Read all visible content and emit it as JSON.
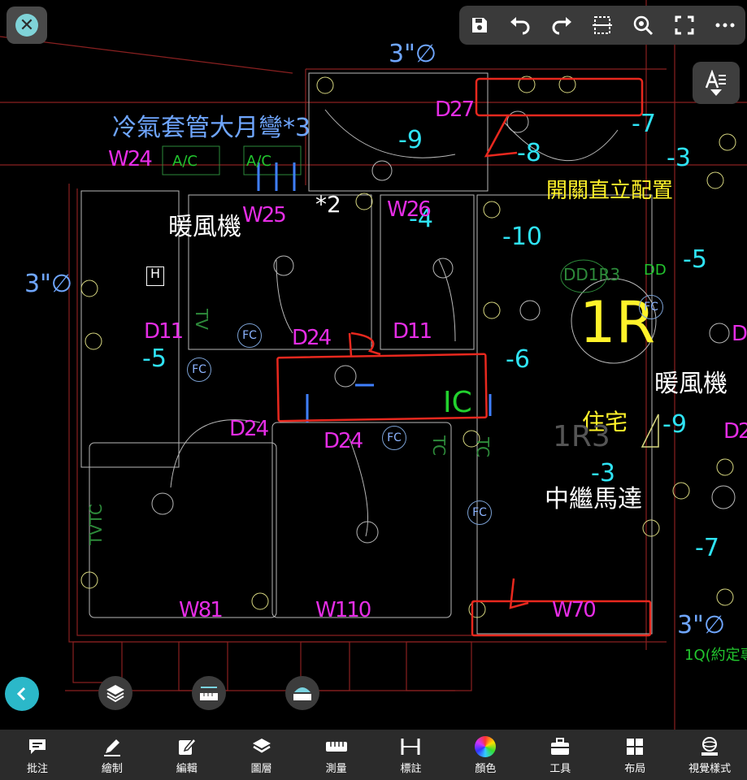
{
  "labels": {
    "pipe_top": "3\"∅",
    "aircon_sleeve": "冷氣套管大月彎*3",
    "heater_left": "暖風機",
    "pipe_left": "3\"∅",
    "switch_vertical": "開關直立配置",
    "heater_right": "暖風機",
    "residence": "住宅",
    "relay_motor": "中繼馬達",
    "pipe_right": "3\"∅",
    "footer_green": "1Q(約定專",
    "ac_1": "A/C",
    "ac_2": "A/C",
    "times_two": "*2",
    "ic": "IC",
    "room_1r": "1R",
    "dd1r3": "DD1R3",
    "r1r3": "1R3",
    "dd": "DD",
    "h_box": "H",
    "d_right": "D",
    "d2_right": "D2",
    "tvtc_1": "TVTC",
    "tvtc_2": "TV",
    "tvtc_3": "TC",
    "tvtc_4": "TC"
  },
  "numbers": {
    "n_minus9_a": "-9",
    "n_minus7_a": "-7",
    "n_minus8": "-8",
    "n_minus3_a": "-3",
    "n_minus4": "-4",
    "n_minus10": "-10",
    "n_minus5_a": "-5",
    "n_minus5_b": "-5",
    "n_minus6": "-6",
    "n_minus9_b": "-9",
    "n_minus3_b": "-3",
    "n_minus7_b": "-7"
  },
  "tags": {
    "w24": "W24",
    "w25": "W25",
    "w26": "W26",
    "d27": "D27",
    "d11_a": "D11",
    "d24_a": "D24",
    "d11_b": "D11",
    "d24_b": "D24",
    "d24_c": "D24",
    "w81": "W81",
    "w110": "W110",
    "w70": "W70"
  },
  "fc": {
    "fc1": "FC",
    "fc2": "FC",
    "fc3": "FC",
    "fc4": "FC",
    "fc5": "FC"
  },
  "markups": {
    "b": "B",
    "l": "L"
  },
  "toolbar": {
    "close": "✕"
  },
  "bottom_tabs": [
    {
      "label": "批注",
      "icon": "comment-icon"
    },
    {
      "label": "繪制",
      "icon": "pencil-icon"
    },
    {
      "label": "編輯",
      "icon": "edit-icon"
    },
    {
      "label": "圖層",
      "icon": "layers-icon"
    },
    {
      "label": "測量",
      "icon": "ruler-icon"
    },
    {
      "label": "標註",
      "icon": "dimension-icon"
    },
    {
      "label": "顏色",
      "icon": "color-wheel-icon"
    },
    {
      "label": "工具",
      "icon": "toolbox-icon"
    },
    {
      "label": "布局",
      "icon": "layout-icon"
    },
    {
      "label": "視覺樣式",
      "icon": "visual-style-icon"
    }
  ],
  "colors": {
    "cyan": "#2fe3f5",
    "magenta": "#e52de5",
    "markup_red": "#e8281e",
    "toolbar_bg": "#3a3a3a",
    "bottom_bar_bg": "#2b2b2b"
  }
}
